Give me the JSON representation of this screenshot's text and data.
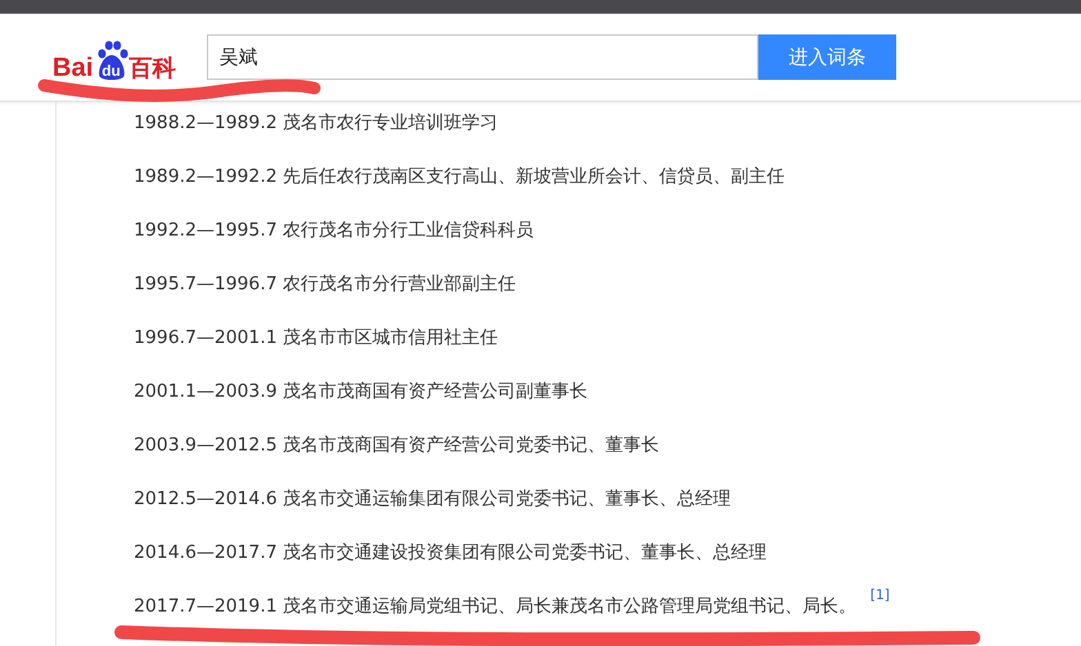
{
  "header": {
    "logo": {
      "latin": "Bai",
      "paw": "du",
      "han": "百科"
    },
    "search": {
      "value": "吴斌"
    },
    "button": "进入词条"
  },
  "entries": [
    {
      "text": "1988.2—1989.2 茂名市农行专业培训班学习"
    },
    {
      "text": "1989.2—1992.2 先后任农行茂南区支行高山、新坡营业所会计、信贷员、副主任"
    },
    {
      "text": "1992.2—1995.7 农行茂名市分行工业信贷科科员"
    },
    {
      "text": "1995.7—1996.7 农行茂名市分行营业部副主任"
    },
    {
      "text": "1996.7—2001.1 茂名市市区城市信用社主任"
    },
    {
      "text": "2001.1—2003.9 茂名市茂商国有资产经营公司副董事长"
    },
    {
      "text": "2003.9—2012.5 茂名市茂商国有资产经营公司党委书记、董事长"
    },
    {
      "text": "2012.5—2014.6 茂名市交通运输集团有限公司党委书记、董事长、总经理"
    },
    {
      "text": "2014.6—2017.7 茂名市交通建设投资集团有限公司党委书记、董事长、总经理"
    },
    {
      "text": "2017.7—2019.1 茂名市交通运输局党组书记、局长兼茂名市公路管理局党组书记、局长。",
      "footnote": "[1]"
    }
  ]
}
